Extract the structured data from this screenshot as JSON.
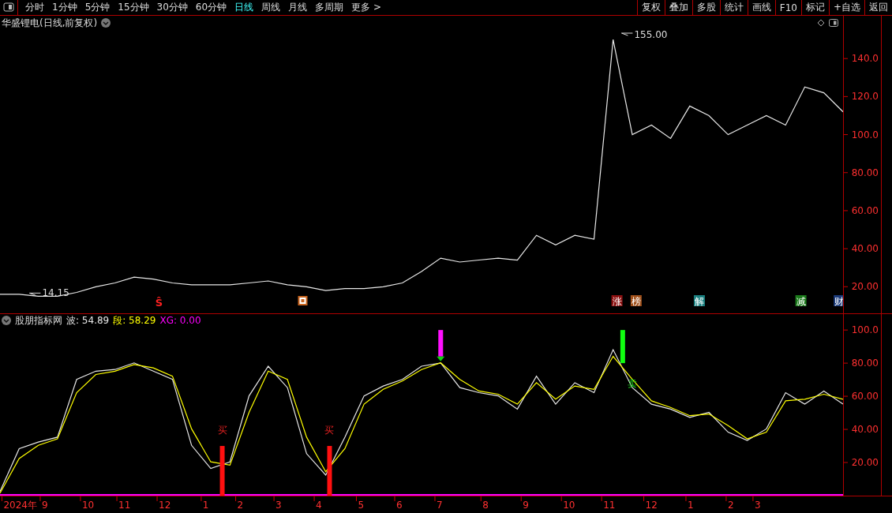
{
  "toolbar": {
    "periods": [
      {
        "label": "分时",
        "selected": false
      },
      {
        "label": "1分钟",
        "selected": false
      },
      {
        "label": "5分钟",
        "selected": false
      },
      {
        "label": "15分钟",
        "selected": false
      },
      {
        "label": "30分钟",
        "selected": false
      },
      {
        "label": "60分钟",
        "selected": false
      },
      {
        "label": "日线",
        "selected": true
      },
      {
        "label": "周线",
        "selected": false
      },
      {
        "label": "月线",
        "selected": false
      },
      {
        "label": "多周期",
        "selected": false
      },
      {
        "label": "更多 >",
        "selected": false
      }
    ],
    "buttons": [
      "复权",
      "叠加",
      "多股",
      "统计",
      "画线",
      "F10",
      "标记",
      "+自选",
      "返回"
    ]
  },
  "price_pane": {
    "title": "华盛锂电(日线,前复权)",
    "chart_data": {
      "type": "line",
      "categories": [
        null,
        null,
        null,
        null,
        null,
        null,
        null,
        null,
        null,
        null,
        null,
        null,
        null,
        null,
        null,
        null,
        null,
        null,
        null,
        null,
        null,
        null,
        null,
        null,
        null,
        null,
        null,
        null,
        null,
        null,
        null,
        null,
        null,
        null,
        null,
        null,
        null,
        null,
        null,
        null,
        null,
        null,
        null,
        null,
        null
      ],
      "series": [
        {
          "color": "#e8e8e8",
          "values": [
            16,
            16,
            15,
            15,
            17,
            20,
            22,
            25,
            24,
            22,
            21,
            21,
            21,
            22,
            23,
            21,
            20,
            18,
            19,
            19,
            20,
            22,
            28,
            35,
            33,
            34,
            35,
            34,
            47,
            42,
            47,
            45,
            150,
            100,
            105,
            98,
            115,
            110,
            100,
            105,
            110,
            105,
            125,
            122,
            112
          ]
        }
      ],
      "ylim": [
        6,
        162.5
      ],
      "yticks": [
        {
          "value": 20,
          "label": "20.00"
        },
        {
          "value": 40,
          "label": "40.00"
        },
        {
          "value": 60,
          "label": "60.00"
        },
        {
          "value": 80,
          "label": "80.00"
        },
        {
          "value": 100,
          "label": "100.0"
        },
        {
          "value": 120,
          "label": "120.0"
        },
        {
          "value": 140,
          "label": "140.0"
        }
      ]
    },
    "price_labels": [
      "155.00",
      "14.15"
    ],
    "events": [
      {
        "kind": "glyph",
        "text": "Ŝ",
        "color": "#ff2020"
      },
      {
        "kind": "square",
        "color": "#c8641e"
      },
      {
        "kind": "tag",
        "text": "涨",
        "color": "#8b1010"
      },
      {
        "kind": "tag",
        "text": "榜",
        "color": "#a0501a"
      },
      {
        "kind": "tag",
        "text": "解",
        "color": "#1a8080"
      },
      {
        "kind": "tag",
        "text": "减",
        "color": "#1a7a1a"
      },
      {
        "kind": "tag",
        "text": "财",
        "color": "#1a3a7a"
      }
    ]
  },
  "indicator_pane": {
    "name": "股朋指标网",
    "readouts": [
      "波: 54.89",
      "段: 58.29",
      "XG: 0.00"
    ],
    "chart_data": {
      "type": "line",
      "categories": [
        null,
        null,
        null,
        null,
        null,
        null,
        null,
        null,
        null,
        null,
        null,
        null,
        null,
        null,
        null,
        null,
        null,
        null,
        null,
        null,
        null,
        null,
        null,
        null,
        null,
        null,
        null,
        null,
        null,
        null,
        null,
        null,
        null,
        null,
        null,
        null,
        null,
        null,
        null,
        null,
        null,
        null,
        null,
        null,
        null
      ],
      "series": [
        {
          "color": "#e8e8e8",
          "values": [
            2,
            28,
            32,
            35,
            70,
            75,
            76,
            80,
            75,
            70,
            30,
            16,
            20,
            60,
            78,
            65,
            25,
            12,
            35,
            60,
            66,
            70,
            78,
            80,
            65,
            62,
            60,
            52,
            72,
            55,
            68,
            62,
            88,
            65,
            55,
            52,
            47,
            50,
            38,
            33,
            40,
            62,
            55,
            63,
            55
          ]
        },
        {
          "color": "#ffff00",
          "values": [
            1,
            22,
            30,
            34,
            62,
            73,
            75,
            79,
            77,
            72,
            40,
            20,
            18,
            50,
            75,
            70,
            35,
            14,
            28,
            55,
            64,
            69,
            76,
            80,
            70,
            63,
            61,
            55,
            68,
            58,
            66,
            64,
            84,
            70,
            57,
            53,
            48,
            49,
            42,
            34,
            38,
            57,
            58,
            61,
            58
          ]
        },
        {
          "color": "#ff00ff",
          "values": [
            0,
            0,
            0,
            0,
            0,
            0,
            0,
            0,
            0,
            0,
            0,
            0,
            0,
            0,
            0,
            0,
            0,
            0,
            0,
            0,
            0,
            0,
            0,
            0,
            0,
            0,
            0,
            0,
            0,
            0,
            0,
            0,
            0,
            0,
            0,
            0,
            0,
            0,
            0,
            0,
            0,
            0,
            0,
            0,
            0
          ]
        }
      ],
      "ylim": [
        0,
        109.6
      ],
      "yticks": [
        {
          "value": 20,
          "label": "20.00"
        },
        {
          "value": 40,
          "label": "40.00"
        },
        {
          "value": 60,
          "label": "60.00"
        },
        {
          "value": 80,
          "label": "80.00"
        },
        {
          "value": 100,
          "label": "100.0"
        }
      ]
    },
    "signals": [
      {
        "kind": "buy",
        "text": "买"
      },
      {
        "kind": "buy",
        "text": "买"
      },
      {
        "kind": "xg"
      },
      {
        "kind": "sell",
        "text": "卖"
      }
    ],
    "date_axis": [
      "2024年",
      "9",
      "10",
      "11",
      "12",
      "1",
      "2",
      "3",
      "4",
      "5",
      "6",
      "7",
      "8",
      "9",
      "10",
      "11",
      "12",
      "1",
      "2",
      "3"
    ]
  }
}
